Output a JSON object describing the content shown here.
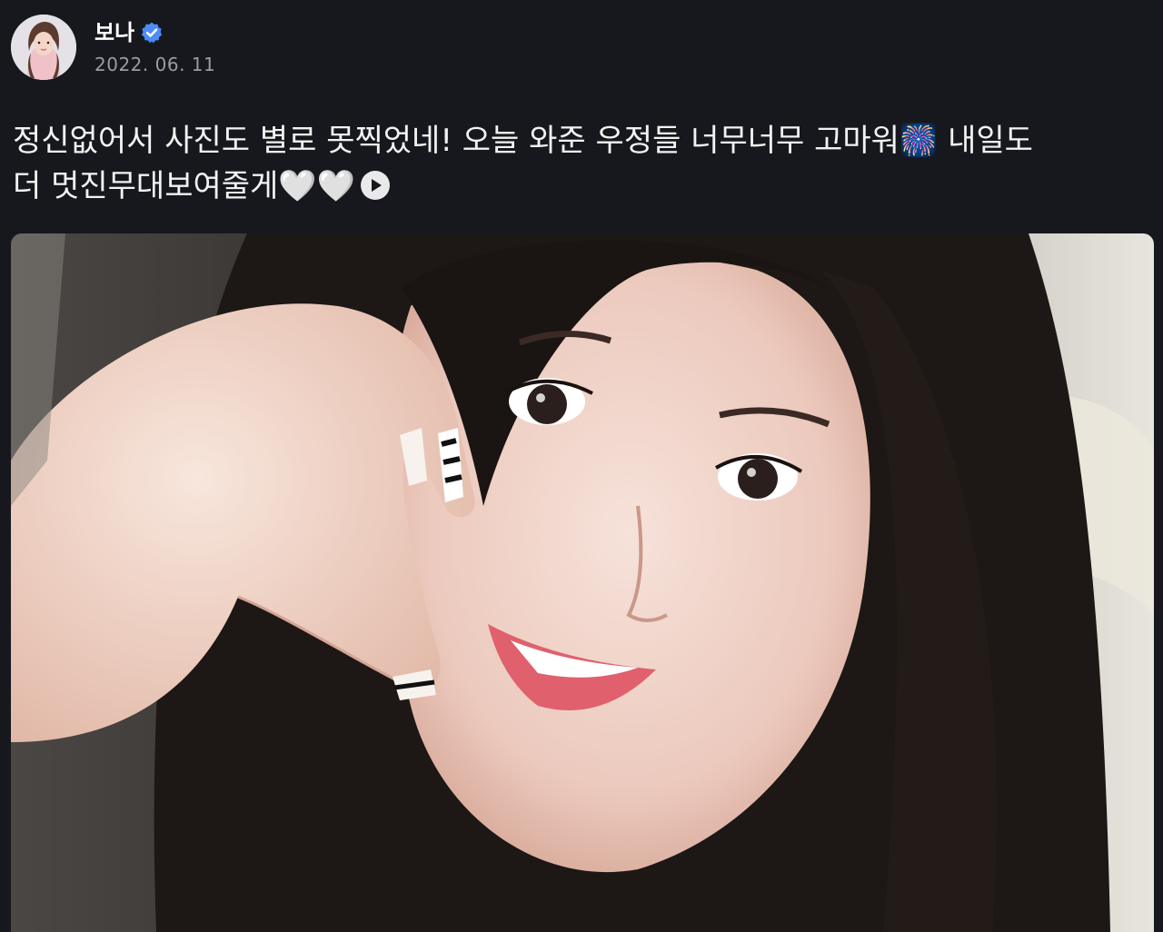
{
  "post": {
    "author_name": "보나",
    "date": "2022. 06. 11",
    "text_line1": "정신없어서 사진도 별로 못찍었네! 오늘 와준 우정들 너무너무 고마워🎆 내일도",
    "text_line2": "더 멋진무대보여줄게🤍🤍"
  },
  "icons": {
    "avatar": "profile-avatar",
    "verified": "verified-badge-icon",
    "play": "play-circle-icon"
  },
  "colors": {
    "background": "#17181d",
    "verified_blue": "#4c8df6",
    "date_gray": "#9b9ca3"
  }
}
